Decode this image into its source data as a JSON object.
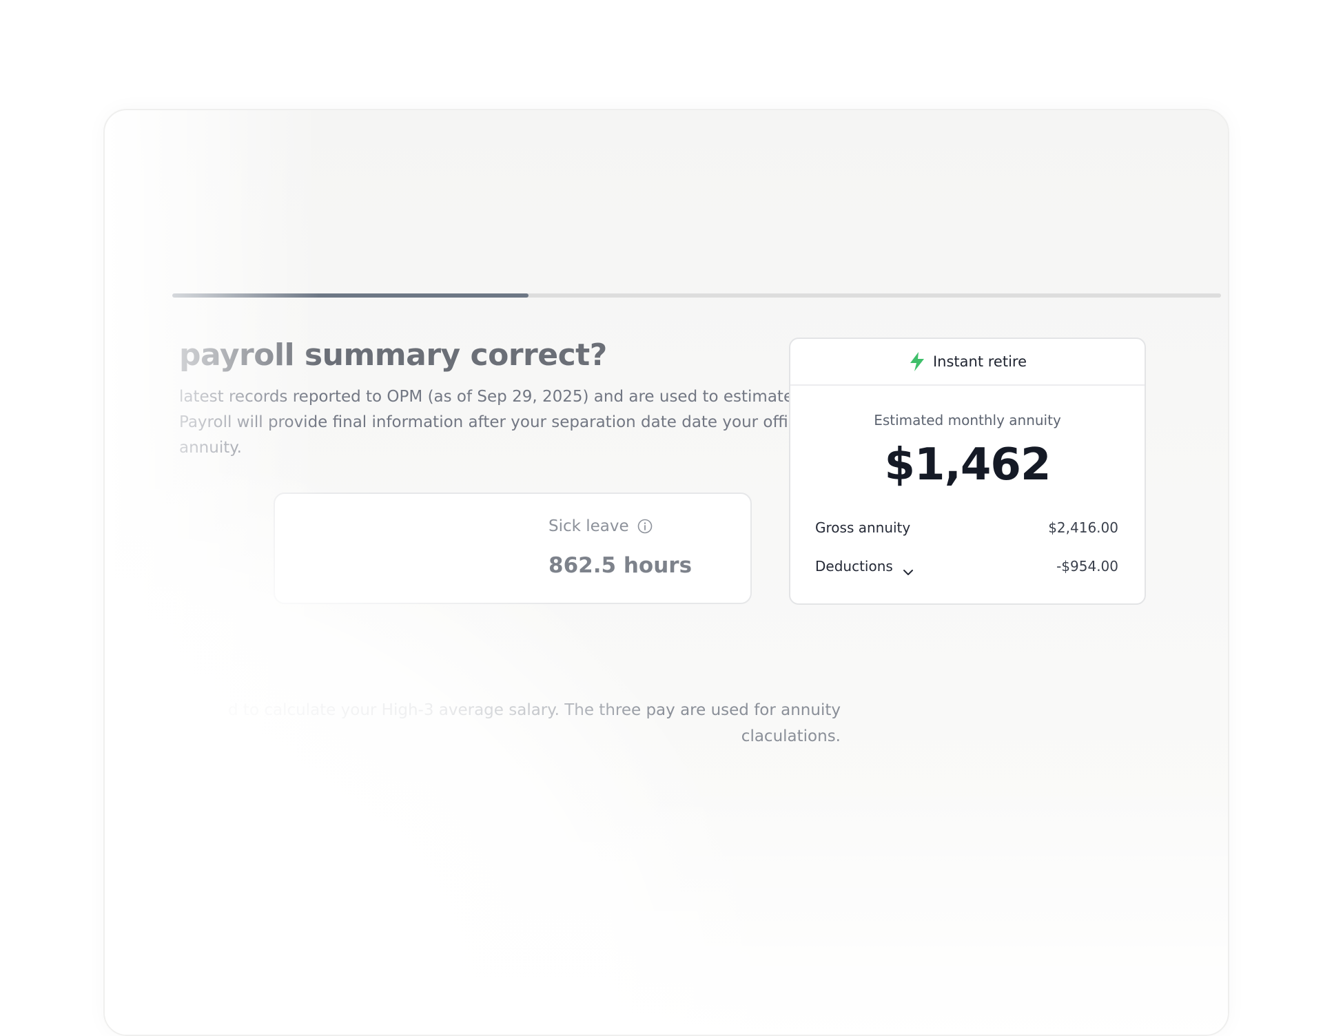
{
  "progress": {
    "fraction": 0.34
  },
  "page": {
    "title": "payroll summary correct?",
    "subtitle": "latest records reported to OPM (as of Sep 29, 2025) and are used to estimate. Payroll will provide final information after your separation date date your official annuity.",
    "high3_text": "d to calculate your High-3 average salary. The three pay are used for annuity claculations."
  },
  "sick_leave": {
    "label": "Sick leave",
    "value": "862.5 hours",
    "icon": "info-icon"
  },
  "annuity_card": {
    "header_label": "Instant retire",
    "header_icon": "lightning-bolt-icon",
    "accent_color": "#3fbf6a",
    "estimate_label": "Estimated monthly annuity",
    "estimate_value": "$1,462",
    "gross_label": "Gross annuity",
    "gross_value": "$2,416.00",
    "deductions_label": "Deductions",
    "deductions_value": "-$954.00",
    "deductions_icon": "chevron-down-icon"
  }
}
